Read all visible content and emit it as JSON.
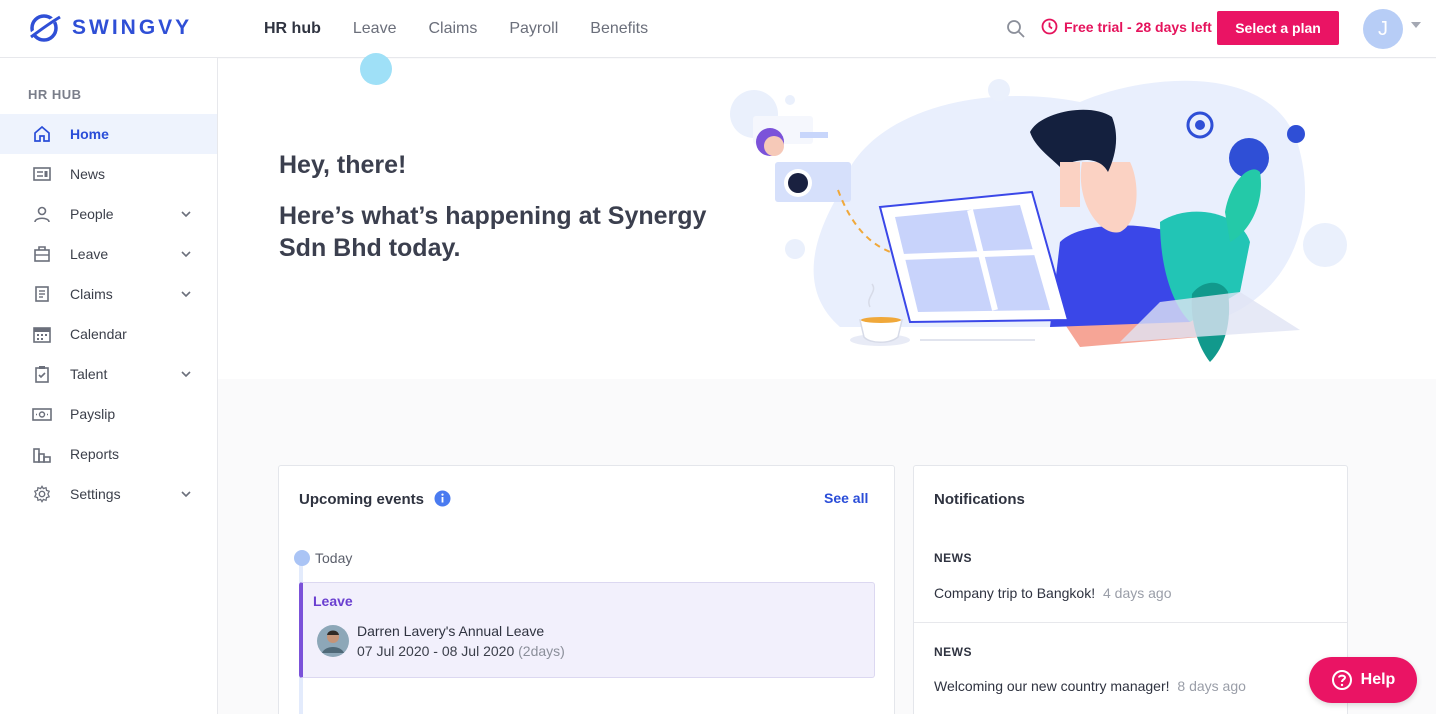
{
  "brand": {
    "name": "SWINGVY",
    "accent": "#2f4fd6",
    "pink": "#ea1464"
  },
  "topnav": {
    "items": [
      "HR hub",
      "Leave",
      "Claims",
      "Payroll",
      "Benefits"
    ],
    "active": "HR hub"
  },
  "trial": {
    "text": "Free trial - 28 days left"
  },
  "plan_button": "Select a plan",
  "user": {
    "initial": "J"
  },
  "sidebar": {
    "title": "HR HUB",
    "items": [
      {
        "label": "Home",
        "icon": "home-icon"
      },
      {
        "label": "News",
        "icon": "news-icon"
      },
      {
        "label": "People",
        "icon": "people-icon"
      },
      {
        "label": "Leave",
        "icon": "leave-icon"
      },
      {
        "label": "Claims",
        "icon": "claims-icon"
      },
      {
        "label": "Calendar",
        "icon": "calendar-icon"
      },
      {
        "label": "Talent",
        "icon": "talent-icon"
      },
      {
        "label": "Payslip",
        "icon": "payslip-icon"
      },
      {
        "label": "Reports",
        "icon": "reports-icon"
      },
      {
        "label": "Settings",
        "icon": "settings-icon"
      }
    ]
  },
  "greeting": {
    "line1": "Hey, there!",
    "line2": "Here’s what’s happening at Synergy Sdn Bhd today."
  },
  "events": {
    "title": "Upcoming events",
    "see_all": "See all",
    "day": "Today",
    "item": {
      "category": "Leave",
      "name": "Darren Lavery's Annual Leave",
      "dates": "07 Jul 2020 - 08 Jul 2020",
      "duration": "(2days)"
    }
  },
  "notifications": {
    "title": "Notifications",
    "items": [
      {
        "type": "NEWS",
        "text": "Company trip to Bangkok!",
        "time": "4 days ago"
      },
      {
        "type": "NEWS",
        "text": "Welcoming our new country manager!",
        "time": "8 days ago"
      }
    ]
  },
  "help": "Help"
}
